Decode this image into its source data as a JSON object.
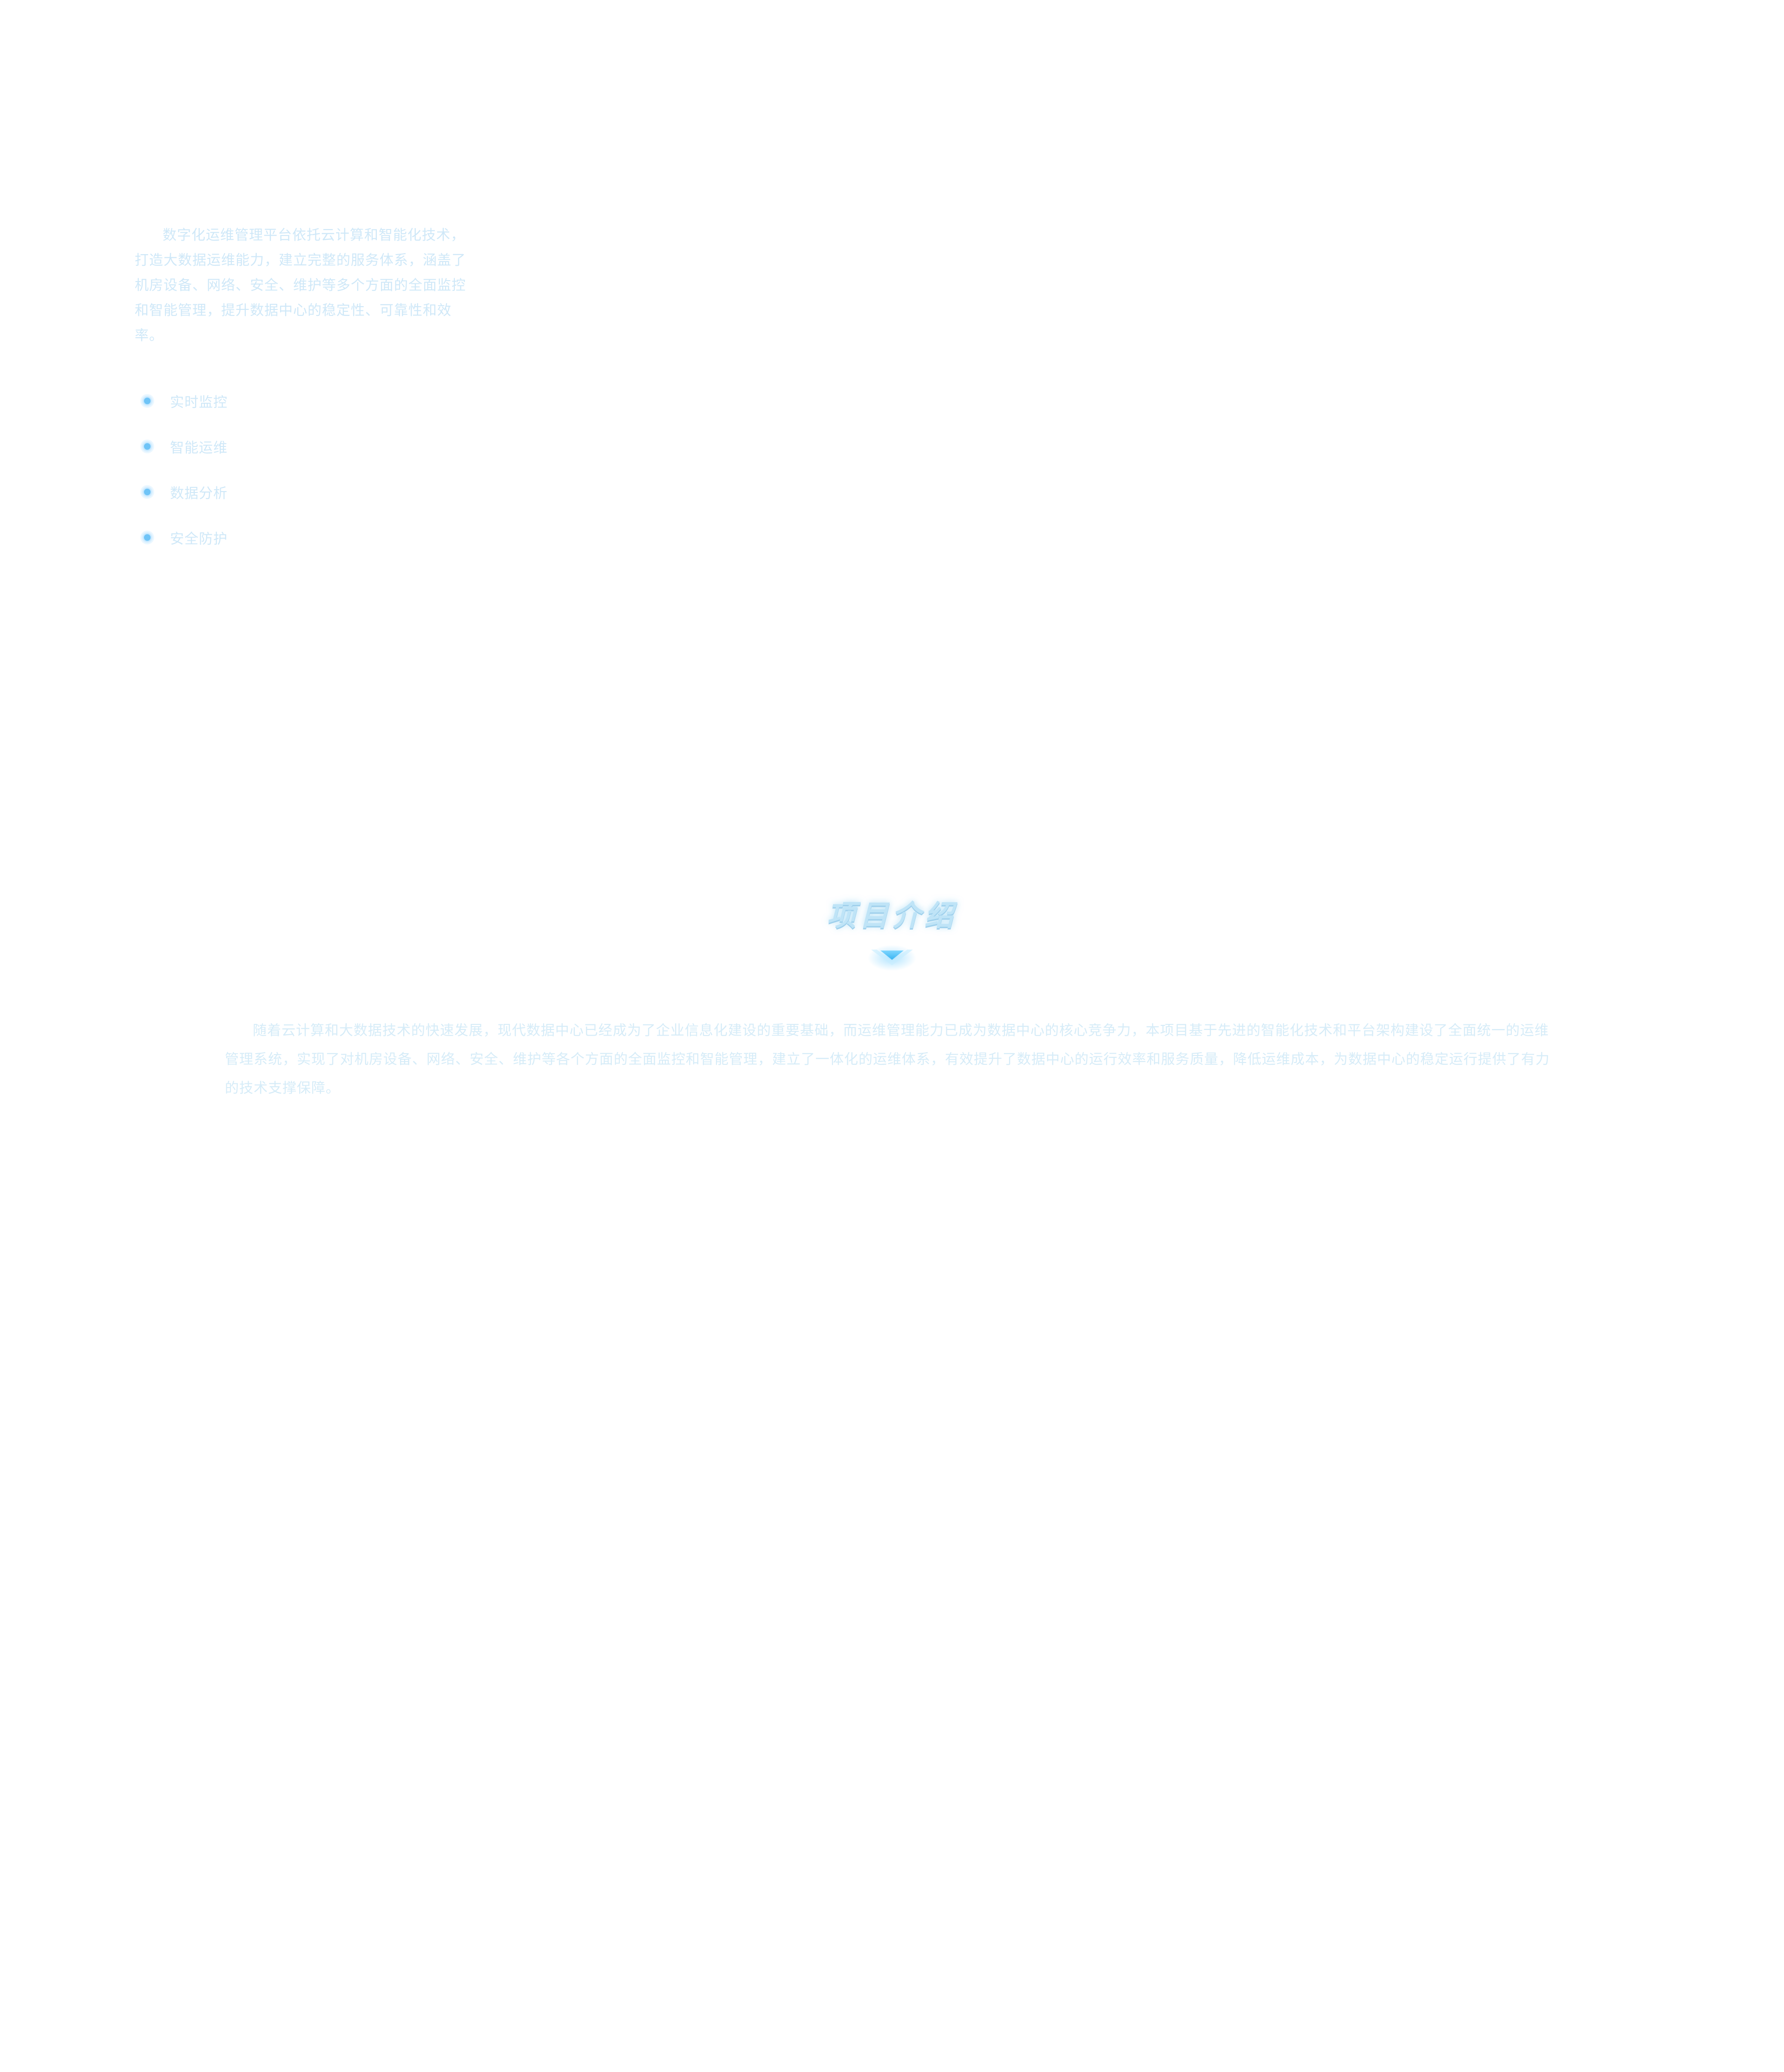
{
  "intro": {
    "text": "数字化运维管理平台依托云计算和智能化技术，打造大数据运维能力，建立完整的服务体系，涵盖了机房设备、网络、安全、维护等多个方面的全面监控和智能管理，提升数据中心的稳定性、可靠性和效率。",
    "features": [
      {
        "label": "实时监控"
      },
      {
        "label": "智能运维"
      },
      {
        "label": "数据分析"
      },
      {
        "label": "安全防护"
      }
    ]
  },
  "section": {
    "title": "项目介绍",
    "arrow_icon": "chevron-down-icon"
  },
  "project": {
    "description": "随着云计算和大数据技术的快速发展，现代数据中心已经成为了企业信息化建设的重要基础，而运维管理能力已成为数据中心的核心竞争力，本项目基于先进的智能化技术和平台架构建设了全面统一的运维管理系统，实现了对机房设备、网络、安全、维护等各个方面的全面监控和智能管理，建立了一体化的运维体系，有效提升了数据中心的运行效率和服务质量，降低运维成本，为数据中心的稳定运行提供了有力的技术支撑保障。"
  },
  "colors": {
    "accent": "#6fc4f7",
    "text": "#cfe8f8",
    "background": "#ffffff"
  }
}
